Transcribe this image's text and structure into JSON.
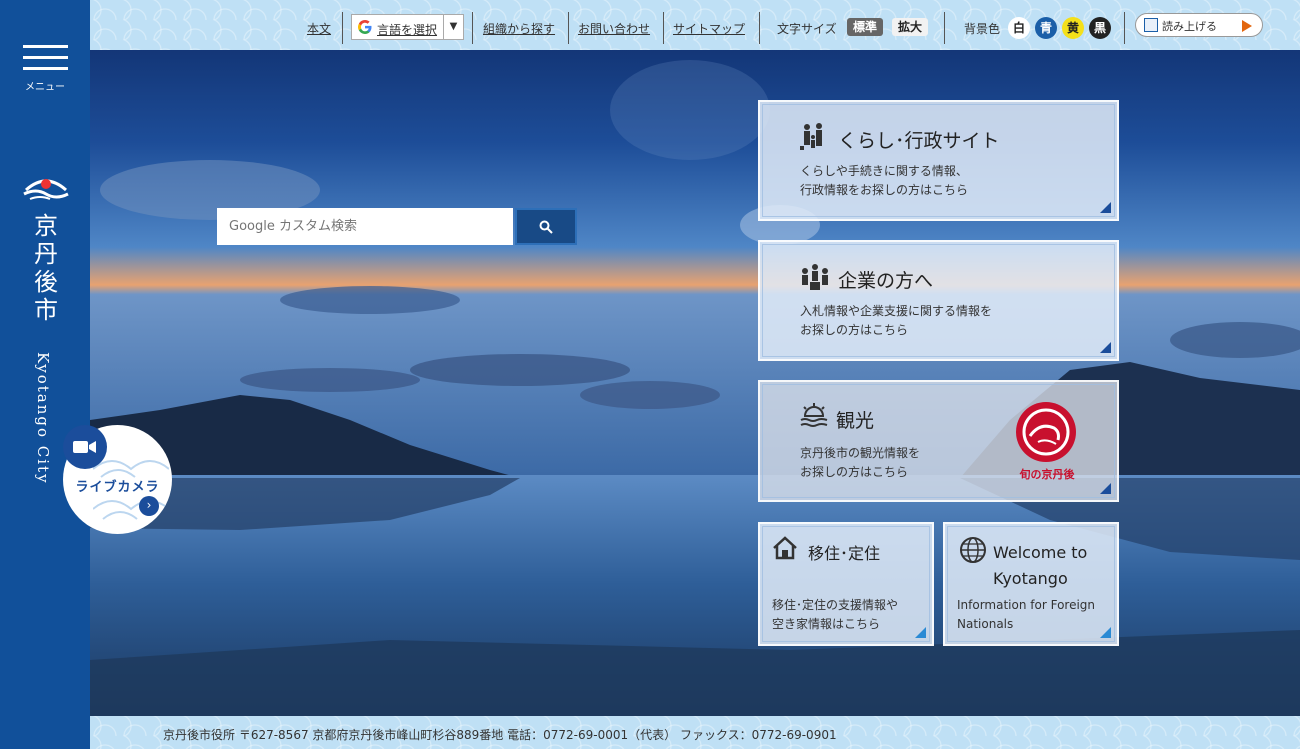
{
  "sidebar": {
    "menu_label": "メニュー",
    "city_name_jp": [
      "京",
      "丹",
      "後",
      "市"
    ],
    "city_name_en": "Kyotango City"
  },
  "topbar": {
    "skip_link": "本文",
    "language_select": "言語を選択",
    "org_search": "組織から探す",
    "contact": "お問い合わせ",
    "sitemap": "サイトマップ",
    "font_size_label": "文字サイズ",
    "font_size_normal": "標準",
    "font_size_large": "拡大",
    "bg_color_label": "背景色",
    "bg_white": "白",
    "bg_blue": "青",
    "bg_yellow": "黄",
    "bg_black": "黒",
    "read_aloud": "読み上げる"
  },
  "search": {
    "placeholder": "Google カスタム検索"
  },
  "cards": {
    "living": {
      "title": "くらし･行政サイト",
      "desc_line1": "くらしや手続きに関する情報、",
      "desc_line2": "行政情報をお探しの方はこちら"
    },
    "business": {
      "title": "企業の方へ",
      "desc_line1": "入札情報や企業支援に関する情報を",
      "desc_line2": "お探しの方はこちら"
    },
    "tourism": {
      "title": "観光",
      "desc_line1": "京丹後市の観光情報を",
      "desc_line2": "お探しの方はこちら",
      "logo_text": "旬の京丹後"
    },
    "migration": {
      "title": "移住･定住",
      "desc_line1": "移住･定住の支援情報や",
      "desc_line2": "空き家情報はこちら"
    },
    "welcome": {
      "title_line1": "Welcome to",
      "title_line2": "Kyotango",
      "desc_line1": "Information for Foreign",
      "desc_line2": "Nationals"
    }
  },
  "livecam": {
    "label": "ライブカメラ"
  },
  "footer": {
    "address": "京丹後市役所 〒627-8567 京都府京丹後市峰山町杉谷889番地 電話：0772-69-0001（代表） ファックス：0772-69-0901"
  },
  "colors": {
    "brand_blue": "#11509a",
    "accent_navy": "#1b4d9b",
    "topbar_bg": "#bfe0f5",
    "tourism_red": "#c8102e",
    "play_orange": "#e2660f"
  }
}
